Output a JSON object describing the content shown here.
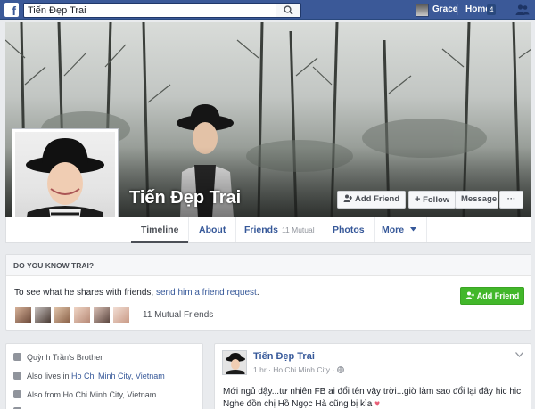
{
  "topbar": {
    "search_value": "Tiến Đẹp Trai",
    "user_name": "Grace",
    "home_label": "Home",
    "home_count": "4",
    "brand_color": "#3b5998"
  },
  "profile": {
    "name": "Tiến Đẹp Trai",
    "buttons": {
      "add_friend": "Add Friend",
      "follow": "Follow",
      "message": "Message",
      "more": "···"
    },
    "tabs": [
      {
        "label": "Timeline",
        "active": true
      },
      {
        "label": "About"
      },
      {
        "label": "Friends",
        "sub": "11 Mutual"
      },
      {
        "label": "Photos"
      },
      {
        "label": "More"
      }
    ]
  },
  "know_box": {
    "heading": "DO YOU KNOW TRAI?",
    "text_before": "To see what he shares with friends, ",
    "link_text": "send him a friend request",
    "text_after": ".",
    "button": "Add Friend",
    "mutual_text": "11 Mutual Friends",
    "button_color": "#42b72a"
  },
  "intro": {
    "row1": "Quỳnh Trần's Brother",
    "row2_prefix": "Also lives in ",
    "row2_link": "Ho Chi Minh City, Vietnam",
    "row3": "Also from Ho Chi Minh City, Vietnam"
  },
  "post": {
    "author": "Tiến Đẹp Trai",
    "meta": "1 hr · Ho Chi Minh City ·",
    "line1": "Mới ngủ dậy...tự nhiên FB ai đổi tên vậy trời...giờ làm sao đổi lại đây hic hic",
    "line2": "Nghe đồn chị Hồ Ngọc Hà cũng bị kìa"
  }
}
